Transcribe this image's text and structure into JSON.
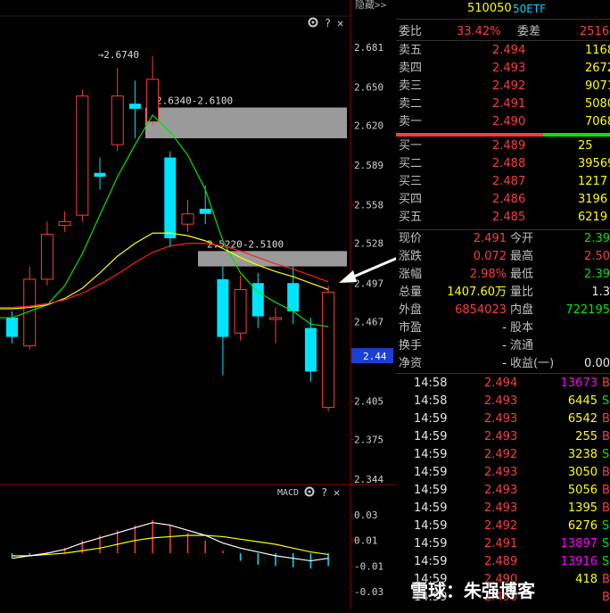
{
  "top_label": "隐藏>>",
  "toolbar_icons": [
    "gear-icon",
    "help-icon",
    "close-icon"
  ],
  "macd_label": "MACD",
  "chart_data": [
    {
      "type": "candlestick",
      "y_ticks": [
        "2.681",
        "2.650",
        "2.620",
        "2.589",
        "2.558",
        "2.528",
        "2.497",
        "2.467",
        "2.44",
        "2.405",
        "2.375",
        "2.344"
      ],
      "ylim": [
        2.344,
        2.681
      ],
      "current_price_tag": "2.44",
      "candles": [
        {
          "o": 2.47,
          "c": 2.455,
          "h": 2.475,
          "l": 2.45
        },
        {
          "o": 2.448,
          "c": 2.5,
          "h": 2.51,
          "l": 2.445
        },
        {
          "o": 2.5,
          "c": 2.535,
          "h": 2.545,
          "l": 2.495
        },
        {
          "o": 2.542,
          "c": 2.545,
          "h": 2.553,
          "l": 2.537
        },
        {
          "o": 2.55,
          "c": 2.643,
          "h": 2.648,
          "l": 2.545
        },
        {
          "o": 2.583,
          "c": 2.58,
          "h": 2.595,
          "l": 2.57
        },
        {
          "o": 2.605,
          "c": 2.643,
          "h": 2.665,
          "l": 2.6
        },
        {
          "o": 2.637,
          "c": 2.633,
          "h": 2.655,
          "l": 2.61
        },
        {
          "o": 2.623,
          "c": 2.656,
          "h": 2.674,
          "l": 2.62
        },
        {
          "o": 2.595,
          "c": 2.532,
          "h": 2.6,
          "l": 2.525
        },
        {
          "o": 2.543,
          "c": 2.551,
          "h": 2.562,
          "l": 2.537
        },
        {
          "o": 2.555,
          "c": 2.551,
          "h": 2.573,
          "l": 2.543
        },
        {
          "o": 2.5,
          "c": 2.455,
          "h": 2.51,
          "l": 2.425
        },
        {
          "o": 2.458,
          "c": 2.492,
          "h": 2.503,
          "l": 2.452
        },
        {
          "o": 2.497,
          "c": 2.471,
          "h": 2.505,
          "l": 2.462
        },
        {
          "o": 2.469,
          "c": 2.47,
          "h": 2.478,
          "l": 2.45
        },
        {
          "o": 2.497,
          "c": 2.475,
          "h": 2.51,
          "l": 2.465
        },
        {
          "o": 2.462,
          "c": 2.428,
          "h": 2.47,
          "l": 2.42
        },
        {
          "o": 2.4,
          "c": 2.49,
          "h": 2.495,
          "l": 2.397
        }
      ],
      "ma_series": [
        {
          "color": "#00e600",
          "values": [
            2.47,
            2.475,
            2.48,
            2.495,
            2.52,
            2.55,
            2.58,
            2.605,
            2.628,
            2.615,
            2.597,
            2.57,
            2.53,
            2.505,
            2.49,
            2.482,
            2.475,
            2.465,
            2.463
          ]
        },
        {
          "color": "#ffff00",
          "values": [
            2.477,
            2.478,
            2.48,
            2.485,
            2.493,
            2.505,
            2.518,
            2.528,
            2.536,
            2.536,
            2.534,
            2.53,
            2.524,
            2.517,
            2.511,
            2.506,
            2.502,
            2.497,
            2.492
          ]
        },
        {
          "color": "#ff2020",
          "values": [
            2.478,
            2.479,
            2.481,
            2.484,
            2.489,
            2.496,
            2.504,
            2.513,
            2.521,
            2.526,
            2.528,
            2.528,
            2.526,
            2.522,
            2.517,
            2.512,
            2.508,
            2.503,
            2.498
          ]
        }
      ],
      "resistance_zones": [
        {
          "label": "2.6340-2.6100",
          "top": 2.634,
          "bottom": 2.61
        },
        {
          "label": "2.5220-2.5100",
          "top": 2.522,
          "bottom": 2.51
        }
      ],
      "high_marker": "2.6740"
    },
    {
      "type": "bar",
      "title": "MACD",
      "y_ticks": [
        "0.03",
        "0.01",
        "-0.01",
        "-0.03"
      ],
      "ylim": [
        -0.035,
        0.035
      ],
      "histogram": [
        -0.004,
        -0.002,
        0.001,
        0.004,
        0.01,
        0.014,
        0.018,
        0.022,
        0.026,
        0.022,
        0.016,
        0.01,
        0.002,
        -0.006,
        -0.009,
        -0.01,
        -0.011,
        -0.012,
        -0.01
      ],
      "dif": [
        -0.004,
        -0.002,
        0.0,
        0.003,
        0.008,
        0.012,
        0.016,
        0.02,
        0.024,
        0.022,
        0.018,
        0.014,
        0.008,
        0.004,
        0.001,
        -0.002,
        -0.004,
        -0.006,
        -0.004
      ],
      "dea": [
        -0.002,
        -0.002,
        -0.001,
        0.0,
        0.002,
        0.004,
        0.007,
        0.01,
        0.012,
        0.013,
        0.014,
        0.014,
        0.013,
        0.011,
        0.009,
        0.007,
        0.004,
        0.001,
        -0.001
      ]
    }
  ],
  "quote": {
    "code": "510050",
    "name": "50ETF",
    "weibi_label": "委比",
    "weibi_value": "33.42%",
    "weicha_label": "委差",
    "weicha_value": "2516",
    "asks": [
      {
        "label": "卖五",
        "price": "2.494",
        "vol": "1168"
      },
      {
        "label": "卖四",
        "price": "2.493",
        "vol": "2672"
      },
      {
        "label": "卖三",
        "price": "2.492",
        "vol": "9071"
      },
      {
        "label": "卖二",
        "price": "2.491",
        "vol": "5080"
      },
      {
        "label": "卖一",
        "price": "2.490",
        "vol": "7068"
      }
    ],
    "bids": [
      {
        "label": "买一",
        "price": "2.489",
        "vol": "25"
      },
      {
        "label": "买二",
        "price": "2.488",
        "vol": "39569"
      },
      {
        "label": "买三",
        "price": "2.487",
        "vol": "1217"
      },
      {
        "label": "买四",
        "price": "2.486",
        "vol": "3196"
      },
      {
        "label": "买五",
        "price": "2.485",
        "vol": "6219"
      }
    ],
    "stats": [
      {
        "l1": "现价",
        "v1": "2.491",
        "c1": "red",
        "l2": "今开",
        "v2": "2.39",
        "c2": "green"
      },
      {
        "l1": "涨跌",
        "v1": "0.072",
        "c1": "red",
        "l2": "最高",
        "v2": "2.50",
        "c2": "red"
      },
      {
        "l1": "涨幅",
        "v1": "2.98%",
        "c1": "red",
        "l2": "最低",
        "v2": "2.39",
        "c2": "green"
      },
      {
        "l1": "总量",
        "v1": "1407.60万",
        "c1": "yellow",
        "l2": "量比",
        "v2": "1.3",
        "c2": "white"
      },
      {
        "l1": "外盘",
        "v1": "6854023",
        "c1": "red",
        "l2": "内盘",
        "v2": "722195",
        "c2": "green"
      },
      {
        "l1": "市盈",
        "v1": "-",
        "c1": "white",
        "l2": "股本",
        "v2": "",
        "c2": "white"
      },
      {
        "l1": "换手",
        "v1": "-",
        "c1": "white",
        "l2": "流通",
        "v2": "",
        "c2": "white"
      },
      {
        "l1": "净资",
        "v1": "-",
        "c1": "white",
        "l2": "收益(一)",
        "v2": "0.00",
        "c2": "white"
      }
    ],
    "ticks": [
      {
        "time": "14:58",
        "price": "2.494",
        "vol": "13673",
        "dir": "B",
        "vc": "magenta"
      },
      {
        "time": "14:58",
        "price": "2.493",
        "vol": "6445",
        "dir": "S",
        "vc": "yellow"
      },
      {
        "time": "14:59",
        "price": "2.493",
        "vol": "6542",
        "dir": "B",
        "vc": "yellow"
      },
      {
        "time": "14:59",
        "price": "2.493",
        "vol": "255",
        "dir": "B",
        "vc": "yellow"
      },
      {
        "time": "14:59",
        "price": "2.492",
        "vol": "3238",
        "dir": "S",
        "vc": "yellow"
      },
      {
        "time": "14:59",
        "price": "2.493",
        "vol": "3050",
        "dir": "B",
        "vc": "yellow"
      },
      {
        "time": "14:59",
        "price": "2.493",
        "vol": "5056",
        "dir": "B",
        "vc": "yellow"
      },
      {
        "time": "14:59",
        "price": "2.493",
        "vol": "1395",
        "dir": "B",
        "vc": "yellow"
      },
      {
        "time": "14:59",
        "price": "2.492",
        "vol": "6276",
        "dir": "S",
        "vc": "yellow"
      },
      {
        "time": "14:59",
        "price": "2.491",
        "vol": "13897",
        "dir": "S",
        "vc": "magenta"
      },
      {
        "time": "14:59",
        "price": "2.489",
        "vol": "13916",
        "dir": "S",
        "vc": "magenta"
      },
      {
        "time": "14:59",
        "price": "2.490",
        "vol": "418",
        "dir": "B",
        "vc": "yellow"
      },
      {
        "time": "14:59",
        "price": "2.490",
        "vol": "",
        "dir": "B",
        "vc": "yellow"
      }
    ]
  },
  "watermark": "雪球：朱强博客"
}
